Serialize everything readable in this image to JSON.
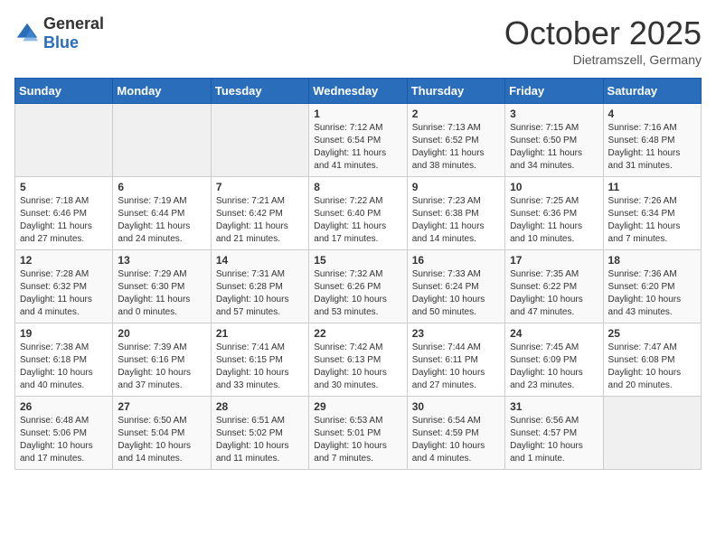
{
  "header": {
    "logo_general": "General",
    "logo_blue": "Blue",
    "month": "October 2025",
    "location": "Dietramszell, Germany"
  },
  "days_of_week": [
    "Sunday",
    "Monday",
    "Tuesday",
    "Wednesday",
    "Thursday",
    "Friday",
    "Saturday"
  ],
  "weeks": [
    [
      {
        "day": "",
        "info": ""
      },
      {
        "day": "",
        "info": ""
      },
      {
        "day": "",
        "info": ""
      },
      {
        "day": "1",
        "info": "Sunrise: 7:12 AM\nSunset: 6:54 PM\nDaylight: 11 hours and 41 minutes."
      },
      {
        "day": "2",
        "info": "Sunrise: 7:13 AM\nSunset: 6:52 PM\nDaylight: 11 hours and 38 minutes."
      },
      {
        "day": "3",
        "info": "Sunrise: 7:15 AM\nSunset: 6:50 PM\nDaylight: 11 hours and 34 minutes."
      },
      {
        "day": "4",
        "info": "Sunrise: 7:16 AM\nSunset: 6:48 PM\nDaylight: 11 hours and 31 minutes."
      }
    ],
    [
      {
        "day": "5",
        "info": "Sunrise: 7:18 AM\nSunset: 6:46 PM\nDaylight: 11 hours and 27 minutes."
      },
      {
        "day": "6",
        "info": "Sunrise: 7:19 AM\nSunset: 6:44 PM\nDaylight: 11 hours and 24 minutes."
      },
      {
        "day": "7",
        "info": "Sunrise: 7:21 AM\nSunset: 6:42 PM\nDaylight: 11 hours and 21 minutes."
      },
      {
        "day": "8",
        "info": "Sunrise: 7:22 AM\nSunset: 6:40 PM\nDaylight: 11 hours and 17 minutes."
      },
      {
        "day": "9",
        "info": "Sunrise: 7:23 AM\nSunset: 6:38 PM\nDaylight: 11 hours and 14 minutes."
      },
      {
        "day": "10",
        "info": "Sunrise: 7:25 AM\nSunset: 6:36 PM\nDaylight: 11 hours and 10 minutes."
      },
      {
        "day": "11",
        "info": "Sunrise: 7:26 AM\nSunset: 6:34 PM\nDaylight: 11 hours and 7 minutes."
      }
    ],
    [
      {
        "day": "12",
        "info": "Sunrise: 7:28 AM\nSunset: 6:32 PM\nDaylight: 11 hours and 4 minutes."
      },
      {
        "day": "13",
        "info": "Sunrise: 7:29 AM\nSunset: 6:30 PM\nDaylight: 11 hours and 0 minutes."
      },
      {
        "day": "14",
        "info": "Sunrise: 7:31 AM\nSunset: 6:28 PM\nDaylight: 10 hours and 57 minutes."
      },
      {
        "day": "15",
        "info": "Sunrise: 7:32 AM\nSunset: 6:26 PM\nDaylight: 10 hours and 53 minutes."
      },
      {
        "day": "16",
        "info": "Sunrise: 7:33 AM\nSunset: 6:24 PM\nDaylight: 10 hours and 50 minutes."
      },
      {
        "day": "17",
        "info": "Sunrise: 7:35 AM\nSunset: 6:22 PM\nDaylight: 10 hours and 47 minutes."
      },
      {
        "day": "18",
        "info": "Sunrise: 7:36 AM\nSunset: 6:20 PM\nDaylight: 10 hours and 43 minutes."
      }
    ],
    [
      {
        "day": "19",
        "info": "Sunrise: 7:38 AM\nSunset: 6:18 PM\nDaylight: 10 hours and 40 minutes."
      },
      {
        "day": "20",
        "info": "Sunrise: 7:39 AM\nSunset: 6:16 PM\nDaylight: 10 hours and 37 minutes."
      },
      {
        "day": "21",
        "info": "Sunrise: 7:41 AM\nSunset: 6:15 PM\nDaylight: 10 hours and 33 minutes."
      },
      {
        "day": "22",
        "info": "Sunrise: 7:42 AM\nSunset: 6:13 PM\nDaylight: 10 hours and 30 minutes."
      },
      {
        "day": "23",
        "info": "Sunrise: 7:44 AM\nSunset: 6:11 PM\nDaylight: 10 hours and 27 minutes."
      },
      {
        "day": "24",
        "info": "Sunrise: 7:45 AM\nSunset: 6:09 PM\nDaylight: 10 hours and 23 minutes."
      },
      {
        "day": "25",
        "info": "Sunrise: 7:47 AM\nSunset: 6:08 PM\nDaylight: 10 hours and 20 minutes."
      }
    ],
    [
      {
        "day": "26",
        "info": "Sunrise: 6:48 AM\nSunset: 5:06 PM\nDaylight: 10 hours and 17 minutes."
      },
      {
        "day": "27",
        "info": "Sunrise: 6:50 AM\nSunset: 5:04 PM\nDaylight: 10 hours and 14 minutes."
      },
      {
        "day": "28",
        "info": "Sunrise: 6:51 AM\nSunset: 5:02 PM\nDaylight: 10 hours and 11 minutes."
      },
      {
        "day": "29",
        "info": "Sunrise: 6:53 AM\nSunset: 5:01 PM\nDaylight: 10 hours and 7 minutes."
      },
      {
        "day": "30",
        "info": "Sunrise: 6:54 AM\nSunset: 4:59 PM\nDaylight: 10 hours and 4 minutes."
      },
      {
        "day": "31",
        "info": "Sunrise: 6:56 AM\nSunset: 4:57 PM\nDaylight: 10 hours and 1 minute."
      },
      {
        "day": "",
        "info": ""
      }
    ]
  ]
}
